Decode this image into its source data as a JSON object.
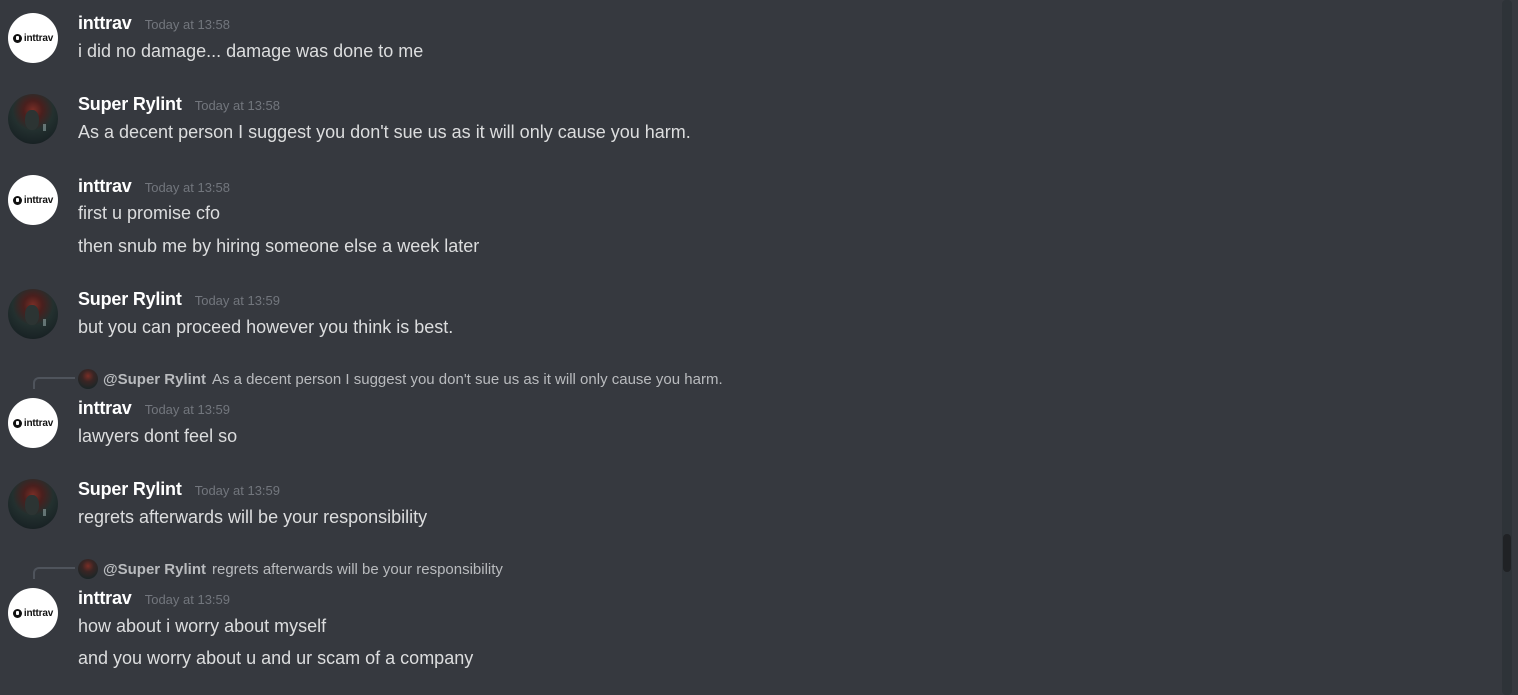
{
  "messages": [
    {
      "author": "inttrav",
      "avatar_text": "inttrav",
      "timestamp": "Today at 13:58",
      "lines": [
        "i did no damage... damage was done to me"
      ]
    },
    {
      "author": "Super Rylint",
      "timestamp": "Today at 13:58",
      "lines": [
        "As a decent person I suggest you don't sue us as it will only cause you harm."
      ]
    },
    {
      "author": "inttrav",
      "avatar_text": "inttrav",
      "timestamp": "Today at 13:58",
      "lines": [
        "first u promise cfo",
        "then snub me by hiring someone else a week later"
      ]
    },
    {
      "author": "Super Rylint",
      "timestamp": "Today at 13:59",
      "lines": [
        "but you can proceed however you think is best."
      ]
    },
    {
      "reply": {
        "mention": "@Super Rylint",
        "text": "As a decent person I suggest you don't sue us as it will only cause you harm."
      },
      "author": "inttrav",
      "avatar_text": "inttrav",
      "timestamp": "Today at 13:59",
      "lines": [
        "lawyers dont feel so"
      ]
    },
    {
      "author": "Super Rylint",
      "timestamp": "Today at 13:59",
      "lines": [
        "regrets afterwards will be your responsibility"
      ]
    },
    {
      "reply": {
        "mention": "@Super Rylint",
        "text": "regrets afterwards will be your responsibility"
      },
      "author": "inttrav",
      "avatar_text": "inttrav",
      "timestamp": "Today at 13:59",
      "lines": [
        "how about i worry about myself",
        "and you worry about u and ur scam of a company"
      ]
    }
  ],
  "colors": {
    "background": "#36393f",
    "username": "#ffffff",
    "message_text": "#dcddde",
    "timestamp": "#72767d",
    "reply_text": "#b9bbbe"
  }
}
